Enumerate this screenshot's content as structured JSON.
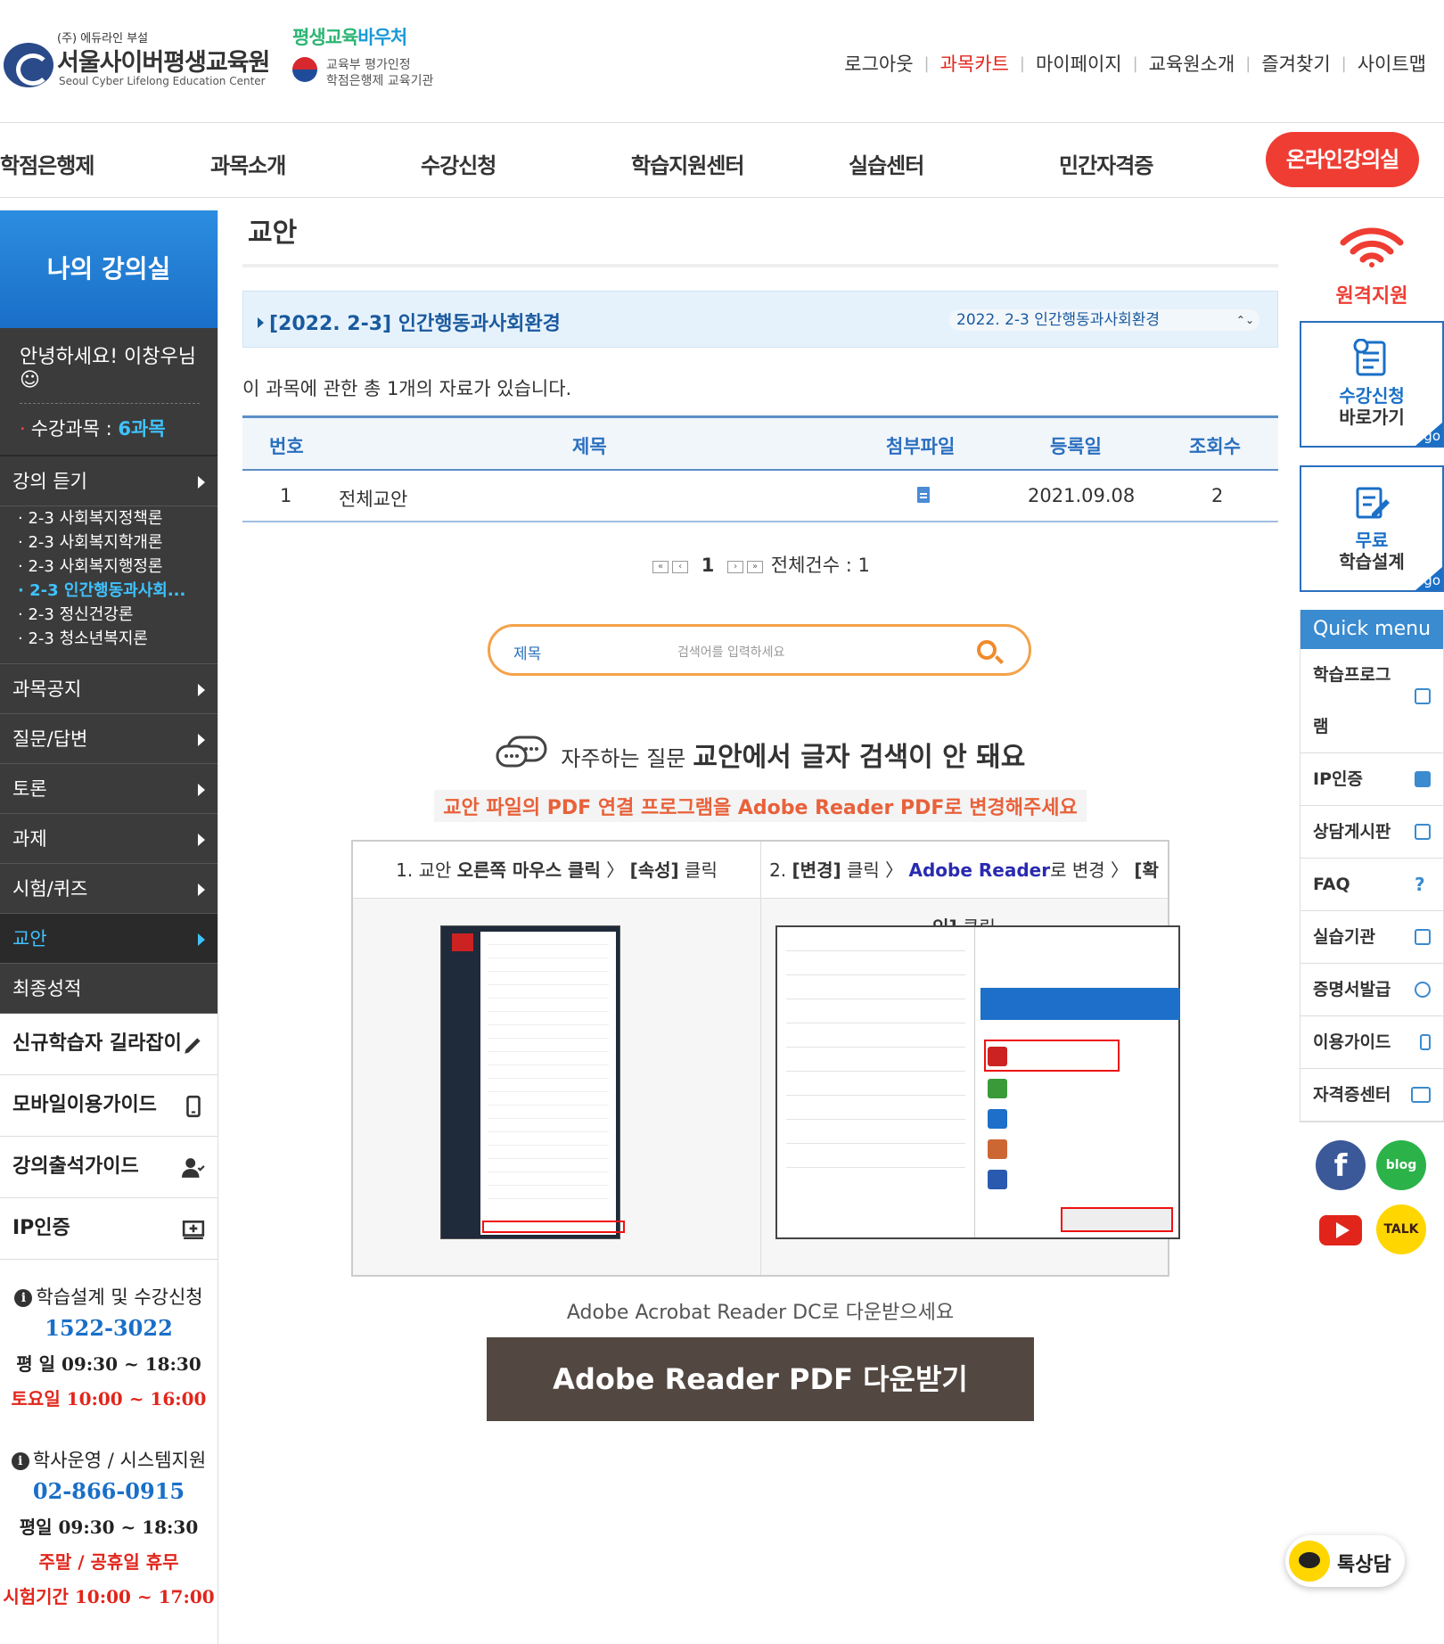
{
  "header": {
    "logo_sub": "(주) 에듀라인 부설",
    "logo_name": "서울사이버평생교육원",
    "logo_en": "Seoul Cyber Lifelong Education Center",
    "badge_top_a": "평생교육",
    "badge_top_b": "바우처",
    "badge_line1": "교육부 평가인정",
    "badge_line2": "학점은행제 교육기관",
    "top_links": [
      "로그아웃",
      "과목카트",
      "마이페이지",
      "교육원소개",
      "즐겨찾기",
      "사이트맵"
    ]
  },
  "gnb": {
    "items": [
      "학점은행제",
      "과목소개",
      "수강신청",
      "학습지원센터",
      "실습센터",
      "민간자격증"
    ],
    "online": "온라인강의실"
  },
  "lnb": {
    "title": "나의 강의실",
    "hello": "안녕하세요! 이창우님☺",
    "course_label": "수강과목 :",
    "course_count": "6과목",
    "lecture_menu": "강의 듣기",
    "sub_items": [
      "2-3 사회복지정책론",
      "2-3 사회복지학개론",
      "2-3 사회복지행정론",
      "2-3 인간행동과사회...",
      "2-3 정신건강론",
      "2-3 청소년복지론"
    ],
    "menu_items": [
      "과목공지",
      "질문/답변",
      "토론",
      "과제",
      "시험/퀴즈",
      "교안",
      "최종성적"
    ],
    "guides": [
      "신규학습자 길라잡이",
      "모바일이용가이드",
      "강의출석가이드",
      "IP인증"
    ],
    "info1_head": "학습설계 및 수강신청",
    "info1_tel": "1522-3022",
    "info1_weekday": "평   일 09:30 ~ 18:30",
    "info1_sat": "토요일 10:00 ~ 16:00",
    "info2_head": "학사운영 / 시스템지원",
    "info2_tel": "02-866-0915",
    "info2_weekday": "평일 09:30 ~ 18:30",
    "info2_closed": "주말 / 공휴일 휴무",
    "info2_exam": "시험기간 10:00 ~ 17:00"
  },
  "main": {
    "title": "교안",
    "course_label": "[2022. 2-3] 인간행동과사회환경",
    "course_select": "2022. 2-3 인간행동과사회환경",
    "summary": "이 과목에 관한 총 1개의 자료가 있습니다.",
    "columns": [
      "번호",
      "제목",
      "첨부파일",
      "등록일",
      "조회수"
    ],
    "rows": [
      {
        "no": "1",
        "title": "전체교안",
        "date": "2021.09.08",
        "views": "2"
      }
    ],
    "pager_current": "1",
    "pager_total": "전체건수 : 1",
    "search_field": "제목",
    "search_placeholder": "검색어를 입력하세요",
    "faq_label": "자주하는 질문",
    "faq_title": "교안에서 글자 검색이 안 돼요",
    "faq_sub": "교안 파일의 PDF 연결 프로그램을 Adobe Reader PDF로 변경해주세요",
    "step1_a": "1. 교안 ",
    "step1_b": "오른쪽 마우스 클릭",
    "step1_c": " 〉 ",
    "step1_d": "[속성]",
    "step1_e": " 클릭",
    "step2_a": "2. ",
    "step2_b": "[변경]",
    "step2_c": " 클릭 〉 ",
    "step2_d": "Adobe Reader",
    "step2_e": "로 변경 〉 ",
    "step2_f": "[확인]",
    "step2_g": " 클릭",
    "download_text": "Adobe Acrobat Reader DC로 다운받으세요",
    "download_button": "Adobe Reader PDF 다운받기"
  },
  "rnb": {
    "remote": "원격지원",
    "apply_1": "수강신청",
    "apply_2": "바로가기",
    "design_1": "무료",
    "design_2": "학습설계",
    "go": "go",
    "quick_title": "Quick menu",
    "quick_items": [
      "학습프로그램",
      "IP인증",
      "상담게시판",
      "FAQ",
      "실습기관",
      "증명서발급",
      "이용가이드",
      "자격증센터"
    ],
    "blog": "blog",
    "talk": "TALK"
  },
  "chatbot": "톡상담"
}
